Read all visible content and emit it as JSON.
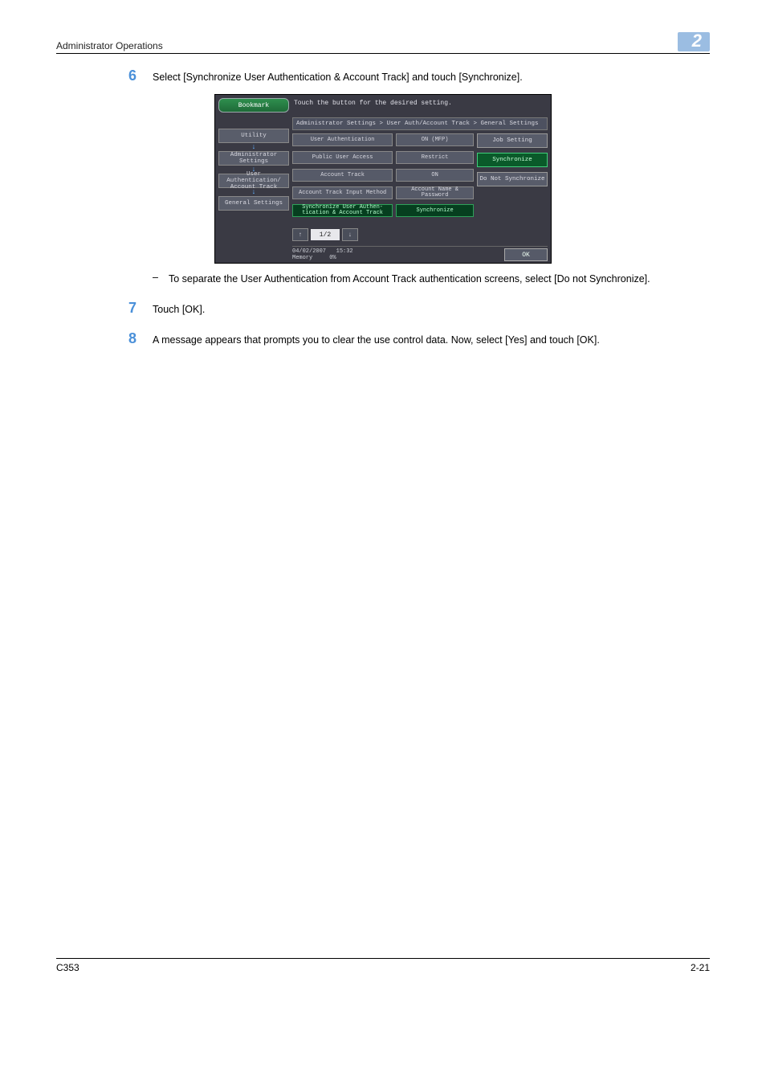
{
  "header": {
    "title": "Administrator Operations",
    "chapter": "2"
  },
  "steps": {
    "s6": {
      "num": "6",
      "text": "Select [Synchronize User Authentication & Account Track] and touch [Synchronize]."
    },
    "dash": "To separate the User Authentication from Account Track authentication screens, select [Do not Synchronize].",
    "s7": {
      "num": "7",
      "text": "Touch [OK]."
    },
    "s8": {
      "num": "8",
      "text": "A message appears that prompts you to clear the use control data. Now, select [Yes] and touch [OK]."
    }
  },
  "panel": {
    "top_msg": "Touch the button for the desired setting.",
    "bookmark": "Bookmark",
    "crumbs": [
      "Utility",
      "Administrator Settings",
      "User Authentication/ Account Track",
      "General Settings"
    ],
    "breadcrumb": "Administrator Settings > User Auth/Account Track  > General Settings",
    "rows": [
      {
        "label": "User Authentication",
        "value": "ON (MFP)",
        "selected": false
      },
      {
        "label": "Public User Access",
        "value": "Restrict",
        "selected": false
      },
      {
        "label": "Account Track",
        "value": "ON",
        "selected": false
      },
      {
        "label": "Account Track Input Method",
        "value": "Account Name & Password",
        "selected": false
      },
      {
        "label": "Synchronize User Authen- tication & Account Track",
        "value": "Synchronize",
        "selected": true
      }
    ],
    "side": {
      "job": "Job Setting",
      "sync": "Synchronize",
      "nosync": "Do Not Synchronize"
    },
    "pager": "1/2",
    "status": {
      "date": "04/02/2007",
      "time": "15:32",
      "mem_label": "Memory",
      "mem_val": "0%"
    },
    "ok": "OK"
  },
  "footer": {
    "model": "C353",
    "page": "2-21"
  }
}
